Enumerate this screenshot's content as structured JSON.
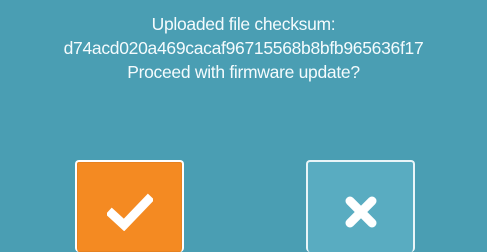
{
  "dialog": {
    "line1": "Uploaded file checksum:",
    "checksum": "d74acd020a469cacaf96715568b8bfb965636f17",
    "question": "Proceed with firmware update?"
  },
  "buttons": {
    "confirm": {
      "icon": "checkmark-icon",
      "color": "#f48a22"
    },
    "cancel": {
      "icon": "close-icon",
      "color": "#59acc1"
    }
  },
  "colors": {
    "background": "#4a9eb3",
    "text": "#ffffff"
  }
}
